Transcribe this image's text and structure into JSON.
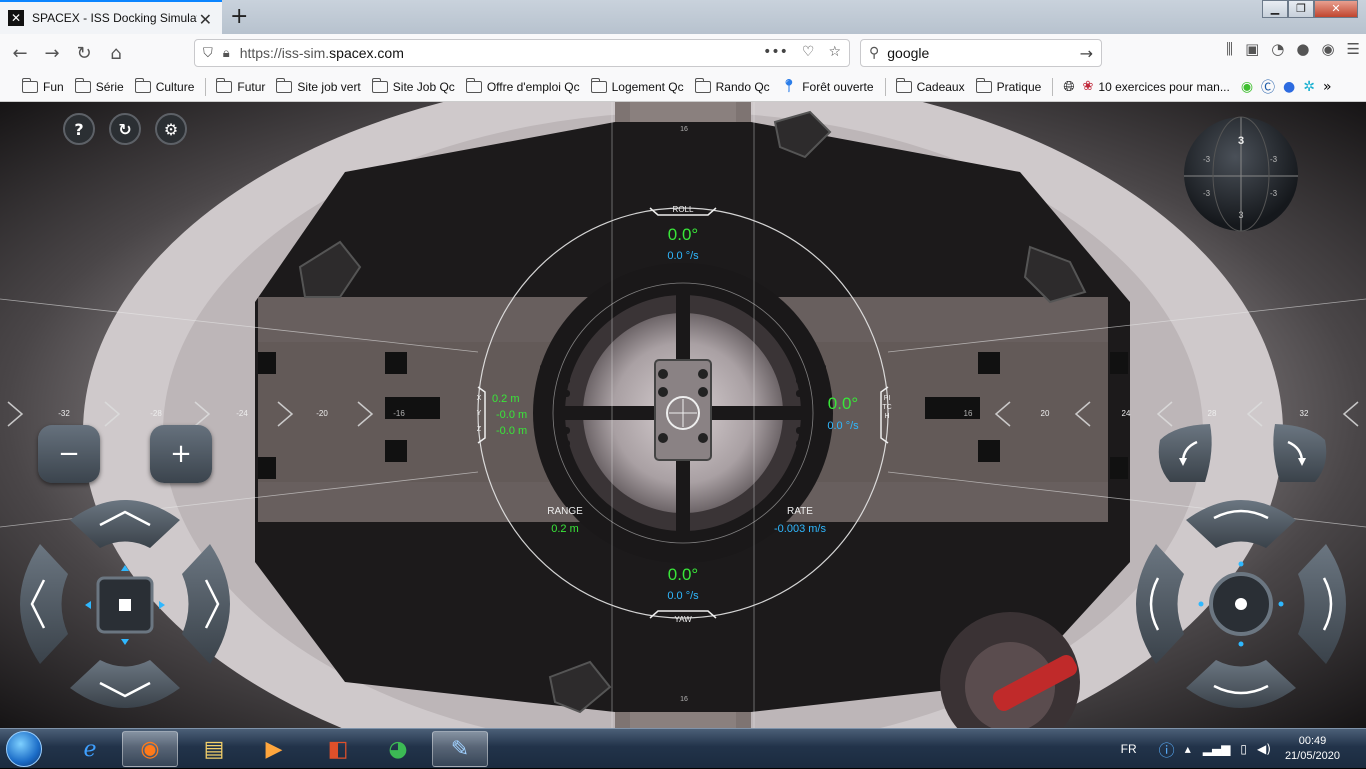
{
  "browser": {
    "tab_title": "SPACEX - ISS Docking Simulator",
    "tab_icon": "spacex-x-icon",
    "url_prefix": "https://iss-sim.",
    "url_domain": "spacex.com",
    "search_value": "google",
    "bookmarks": [
      {
        "label": "Fun",
        "icon": "folder-icon"
      },
      {
        "label": "Série",
        "icon": "folder-icon"
      },
      {
        "label": "Culture",
        "icon": "folder-icon"
      },
      {
        "label": "Futur",
        "icon": "folder-icon"
      },
      {
        "label": "Site job vert",
        "icon": "folder-icon"
      },
      {
        "label": "Site Job Qc",
        "icon": "folder-icon"
      },
      {
        "label": "Offre d'emploi Qc",
        "icon": "folder-icon"
      },
      {
        "label": "Logement Qc",
        "icon": "folder-icon"
      },
      {
        "label": "Rando Qc",
        "icon": "folder-icon"
      },
      {
        "label": "Forêt ouverte",
        "icon": "map-pin-icon"
      },
      {
        "label": "Cadeaux",
        "icon": "folder-icon"
      },
      {
        "label": "Pratique",
        "icon": "folder-icon"
      },
      {
        "label": "10 exercices pour man...",
        "icon": "raspberry-icon"
      }
    ]
  },
  "hud": {
    "roll_label": "ROLL",
    "roll_value": "0.0°",
    "roll_rate": "0.0 °/s",
    "pitch_label": "PITCH",
    "pitch_value": "0.0°",
    "pitch_rate": "0.0 °/s",
    "yaw_label": "YAW",
    "yaw_value": "0.0°",
    "yaw_rate": "0.0 °/s",
    "xyz_labels": [
      "X",
      "Y",
      "Z"
    ],
    "x_value": "0.2 m",
    "y_value": "-0.0 m",
    "z_value": "-0.0 m",
    "range_label": "RANGE",
    "range_value": "0.2 m",
    "rate_label": "RATE",
    "rate_value": "-0.003 m/s",
    "scale_ticks": [
      "-32",
      "-28",
      "-24",
      "-20",
      "-16",
      "16",
      "20",
      "24",
      "28",
      "32"
    ],
    "top_tick": "16",
    "bottom_tick": "16",
    "colors": {
      "green": "#39e639",
      "cyan": "#2fb8ff"
    }
  },
  "controls": {
    "help_label": "?",
    "minus_label": "−",
    "plus_label": "+"
  },
  "taskbar": {
    "language": "FR",
    "time": "00:49",
    "date": "21/05/2020",
    "apps": [
      "internet-explorer-icon",
      "firefox-icon",
      "file-explorer-icon",
      "media-player-icon",
      "powerpoint-icon",
      "chrome-icon",
      "paint-icon"
    ]
  }
}
